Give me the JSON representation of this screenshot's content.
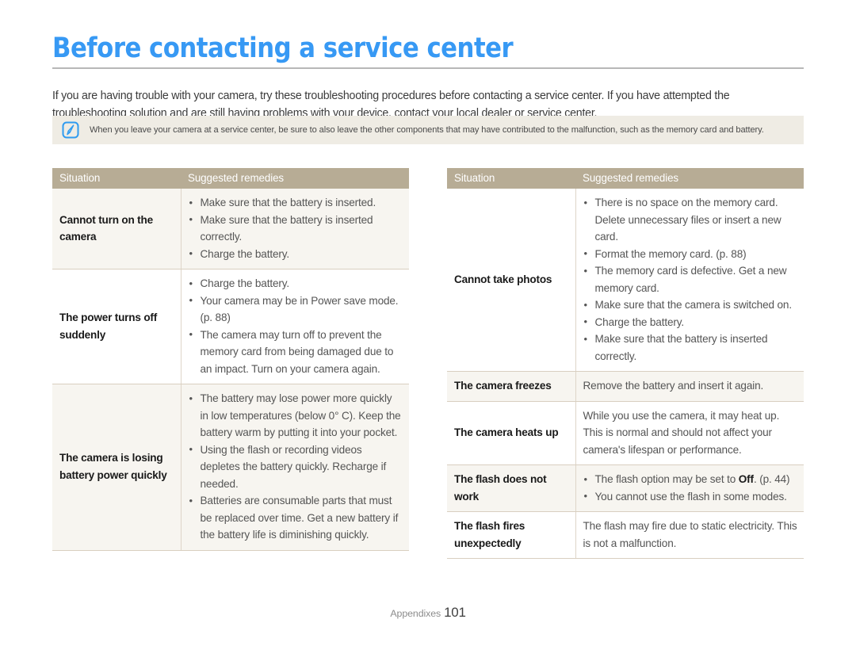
{
  "page": {
    "title": "Before contacting a service center",
    "intro": "If you are having trouble with your camera, try these troubleshooting procedures before contacting a service center. If you have attempted the troubleshooting solution and are still having problems with your device, contact your local dealer or service center.",
    "note": {
      "icon": "note-pen-icon",
      "text": "When you leave your camera at a service center, be sure to also leave the other components that may have contributed to the malfunction, such as the memory card and battery."
    },
    "footer": {
      "label": "Appendixes",
      "page_number": "101"
    }
  },
  "colors": {
    "title_blue": "#3799f4",
    "table_header_tan": "#b7ac95",
    "row_shaded": "#f7f5f0",
    "row_plain": "#ffffff",
    "note_background": "#efece4",
    "note_icon_blue": "#2f9bf0",
    "row_border": "#d9cfc0"
  },
  "tables": {
    "columns": {
      "situation": "Situation",
      "remedies": "Suggested remedies"
    },
    "left_rows": [
      {
        "situation": "Cannot turn on the camera",
        "shaded": true,
        "bullets": [
          "Make sure that the battery is inserted.",
          "Make sure that the battery is inserted correctly.",
          "Charge the battery."
        ]
      },
      {
        "situation": "The power turns off suddenly",
        "shaded": false,
        "bullets": [
          "Charge the battery.",
          "Your camera may be in Power save mode. (p. 88)",
          "The camera may turn off to prevent the memory card from being damaged due to an impact. Turn on your camera again."
        ]
      },
      {
        "situation": "The camera is losing battery power quickly",
        "shaded": true,
        "bullets": [
          "The battery may lose power more quickly in low temperatures (below 0° C). Keep the battery warm by putting it into your pocket.",
          "Using the flash or recording videos depletes the battery quickly. Recharge if needed.",
          "Batteries are consumable parts that must be replaced over time. Get a new battery if the battery life is diminishing quickly."
        ]
      }
    ],
    "right_rows": [
      {
        "situation": "Cannot take photos",
        "shaded": false,
        "bullets": [
          "There is no space on the memory card. Delete unnecessary files or insert a new card.",
          "Format the memory card. (p. 88)",
          "The memory card is defective. Get a new memory card.",
          "Make sure that the camera is switched on.",
          "Charge the battery.",
          "Make sure that the battery is inserted correctly."
        ]
      },
      {
        "situation": "The camera freezes",
        "shaded": true,
        "plain_text": "Remove the battery and insert it again."
      },
      {
        "situation": "The camera heats up",
        "shaded": false,
        "plain_text": "While you use the camera, it may heat up. This is normal and should not affect your camera's lifespan or performance."
      },
      {
        "situation": "The flash does not work",
        "shaded": true,
        "bullets_html": [
          "The flash option may be set to <b class=\"inline-b\">Off</b>. (p. 44)",
          "You cannot use the flash in some modes."
        ]
      },
      {
        "situation": "The flash fires unexpectedly",
        "shaded": false,
        "plain_text": "The flash may fire due to static electricity. This is not a malfunction."
      }
    ]
  }
}
